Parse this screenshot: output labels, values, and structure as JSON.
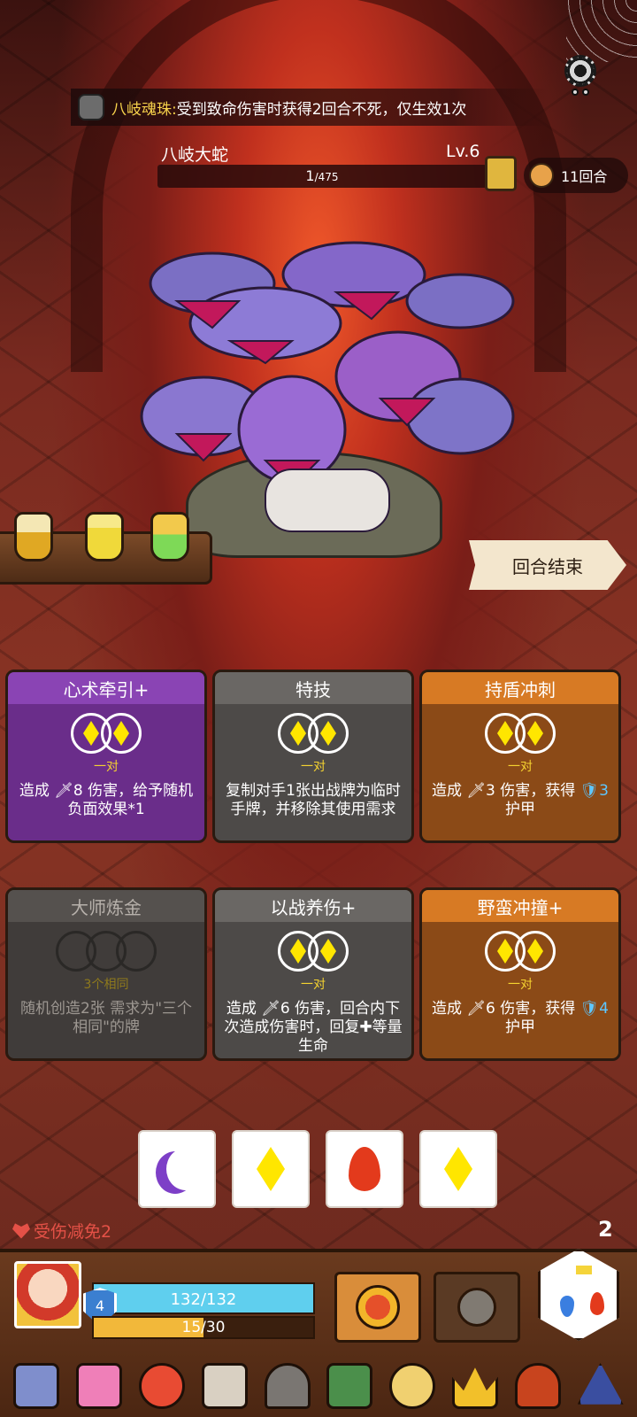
{
  "relic_banner": {
    "name": "八岐魂珠:",
    "desc": "受到致命伤害时获得2回合不死，仅生效1次"
  },
  "boss": {
    "name": "八岐大蛇",
    "level": "Lv.6",
    "hp_current": "1",
    "hp_max": "/475"
  },
  "turn_counter": "11回合",
  "end_turn_label": "回合结束",
  "cards": [
    {
      "title": "心术牵引+",
      "req": "一对",
      "desc": "造成 🗡8 伤害，给予随机负面效果*1",
      "style": "purple"
    },
    {
      "title": "特技",
      "req": "一对",
      "desc": "复制对手1张出战牌为临时手牌，并移除其使用需求",
      "style": "gray"
    },
    {
      "title": "持盾冲刺",
      "req": "一对",
      "desc_a": "造成 🗡3 伤害，获得 ",
      "shield": "🛡3",
      "desc_b": "护甲",
      "style": "orange"
    },
    {
      "title": "大师炼金",
      "req": "3个相同",
      "desc": "随机创造2张 需求为\"三个相同\"的牌",
      "style": "disabled"
    },
    {
      "title": "以战养伤+",
      "req": "一对",
      "desc": "造成 🗡6 伤害，回合内下次造成伤害时，回复✚等量生命",
      "style": "gray"
    },
    {
      "title": "野蛮冲撞+",
      "req": "一对",
      "desc_a": "造成 🗡6 伤害，获得 ",
      "shield": "🛡4",
      "desc_b": "护甲",
      "style": "orange"
    }
  ],
  "dice": [
    "moon",
    "diamond",
    "flame",
    "diamond"
  ],
  "status": {
    "damage_reduction": "受伤减免2",
    "reroll_count": "2"
  },
  "player": {
    "armor": "4",
    "hp": "132/132",
    "energy": "15/30",
    "energy_fraction": 0.5
  },
  "relics": [
    "wing-relic",
    "heart-book-relic",
    "ring-relic",
    "scroll-relic",
    "helmet-relic",
    "spellbook-relic",
    "medallion-relic",
    "crown-relic",
    "hood-relic",
    "triangle-relic"
  ]
}
